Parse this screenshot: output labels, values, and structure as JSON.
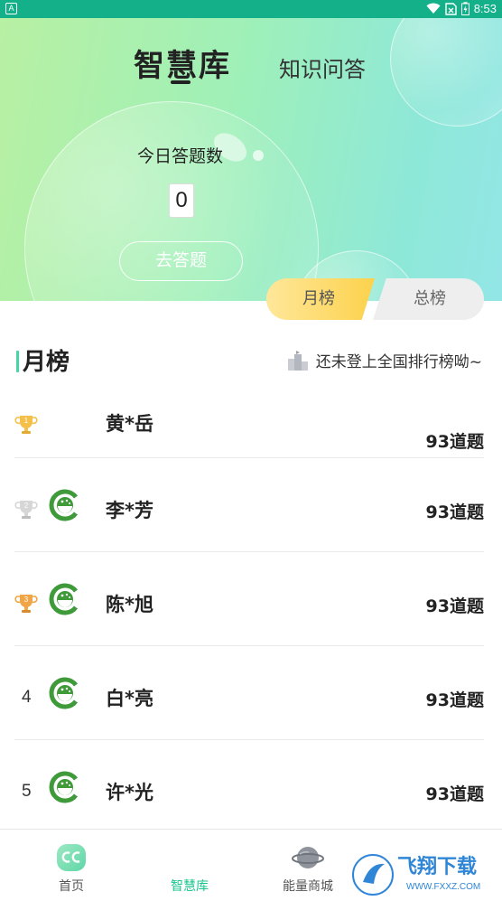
{
  "status_bar": {
    "left_badge": "A",
    "time": "8:53"
  },
  "header": {
    "tabs": [
      {
        "label": "智慧库",
        "active": true
      },
      {
        "label": "知识问答",
        "active": false
      }
    ]
  },
  "today": {
    "label": "今日答题数",
    "count": "0",
    "button": "去答题"
  },
  "segment": {
    "month": "月榜",
    "total": "总榜",
    "selected": "月榜"
  },
  "section": {
    "title": "月榜",
    "rank_note": "还未登上全国排行榜呦~"
  },
  "leaderboard": [
    {
      "rank": "1",
      "name": "黄*岳",
      "count": "93道题",
      "medal": "gold",
      "has_avatar": false
    },
    {
      "rank": "2",
      "name": "李*芳",
      "count": "93道题",
      "medal": "silver",
      "has_avatar": true
    },
    {
      "rank": "3",
      "name": "陈*旭",
      "count": "93道题",
      "medal": "bronze",
      "has_avatar": true
    },
    {
      "rank": "4",
      "name": "白*亮",
      "count": "93道题",
      "medal": null,
      "has_avatar": true
    },
    {
      "rank": "5",
      "name": "许*光",
      "count": "93道题",
      "medal": null,
      "has_avatar": true
    }
  ],
  "tabbar": [
    {
      "label": "首页",
      "icon": "home-cc-icon",
      "active": false
    },
    {
      "label": "智慧库",
      "icon": "",
      "active": true
    },
    {
      "label": "能量商城",
      "icon": "planet-icon",
      "active": false
    }
  ],
  "watermark": {
    "text": "飞翔下载",
    "url": "WWW.FXXZ.COM"
  },
  "colors": {
    "accent": "#19c48d",
    "status_bar": "#14b08a",
    "month_tab": "#fcd24c"
  }
}
